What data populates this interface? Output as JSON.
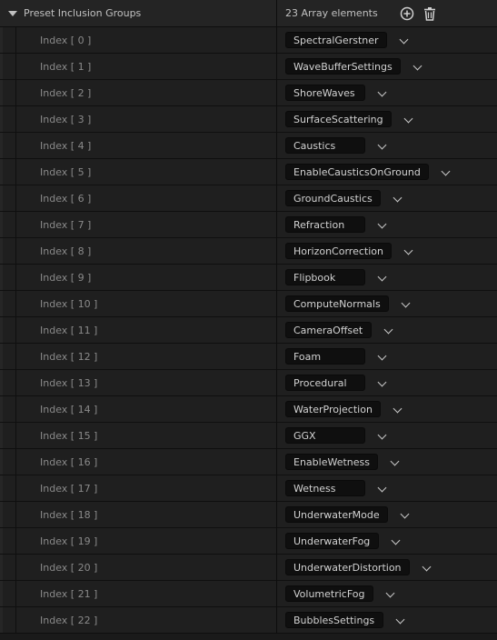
{
  "group": {
    "title": "Preset Inclusion Groups",
    "count_label": "23 Array elements",
    "add_icon": "add-circle-icon",
    "delete_icon": "trash-icon"
  },
  "items": [
    {
      "label": "Index [ 0 ]",
      "value": "SpectralGerstner"
    },
    {
      "label": "Index [ 1 ]",
      "value": "WaveBufferSettings"
    },
    {
      "label": "Index [ 2 ]",
      "value": "ShoreWaves"
    },
    {
      "label": "Index [ 3 ]",
      "value": "SurfaceScattering"
    },
    {
      "label": "Index [ 4 ]",
      "value": "Caustics"
    },
    {
      "label": "Index [ 5 ]",
      "value": "EnableCausticsOnGround"
    },
    {
      "label": "Index [ 6 ]",
      "value": "GroundCaustics"
    },
    {
      "label": "Index [ 7 ]",
      "value": "Refraction"
    },
    {
      "label": "Index [ 8 ]",
      "value": "HorizonCorrection"
    },
    {
      "label": "Index [ 9 ]",
      "value": "Flipbook"
    },
    {
      "label": "Index [ 10 ]",
      "value": "ComputeNormals"
    },
    {
      "label": "Index [ 11 ]",
      "value": "CameraOffset"
    },
    {
      "label": "Index [ 12 ]",
      "value": "Foam"
    },
    {
      "label": "Index [ 13 ]",
      "value": "Procedural"
    },
    {
      "label": "Index [ 14 ]",
      "value": "WaterProjection"
    },
    {
      "label": "Index [ 15 ]",
      "value": "GGX"
    },
    {
      "label": "Index [ 16 ]",
      "value": "EnableWetness"
    },
    {
      "label": "Index [ 17 ]",
      "value": "Wetness"
    },
    {
      "label": "Index [ 18 ]",
      "value": "UnderwaterMode"
    },
    {
      "label": "Index [ 19 ]",
      "value": "UnderwaterFog"
    },
    {
      "label": "Index [ 20 ]",
      "value": "UnderwaterDistortion"
    },
    {
      "label": "Index [ 21 ]",
      "value": "VolumetricFog"
    },
    {
      "label": "Index [ 22 ]",
      "value": "BubblesSettings"
    }
  ]
}
